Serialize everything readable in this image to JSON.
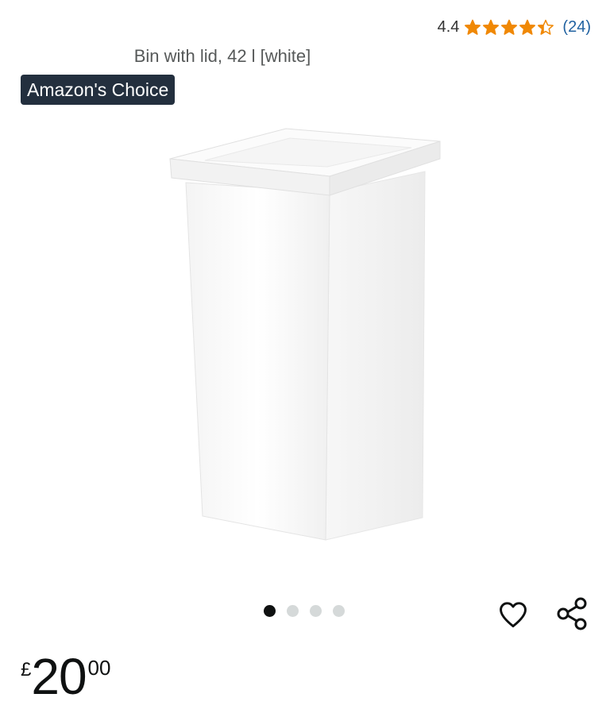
{
  "rating": {
    "value": "4.4",
    "stars": 4.4,
    "count": "(24)",
    "star_color": "#f08804"
  },
  "product": {
    "title": "Bin with lid, 42 l [white]"
  },
  "badge": {
    "label": "Amazon's Choice",
    "background": "#232f3e"
  },
  "carousel": {
    "total": 4,
    "active_index": 0
  },
  "price": {
    "symbol": "£",
    "whole": "20",
    "fraction": "00"
  },
  "icons": {
    "wishlist": "heart-icon",
    "share": "share-icon"
  }
}
